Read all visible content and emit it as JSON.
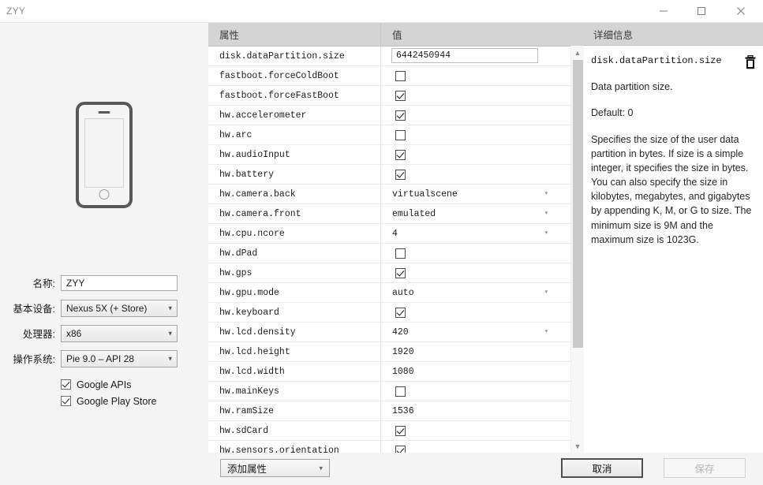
{
  "window": {
    "title": "ZYY",
    "controls": {
      "minimize": "minimize-icon",
      "maximize": "maximize-icon",
      "close": "close-icon"
    }
  },
  "sidebar": {
    "device_preview_icon": "phone-illustration",
    "fields": [
      {
        "label": "名称:",
        "type": "text",
        "value": "ZYY"
      },
      {
        "label": "基本设备:",
        "type": "combo",
        "value": "Nexus 5X (+ Store)"
      },
      {
        "label": "处理器:",
        "type": "combo",
        "value": "x86"
      },
      {
        "label": "操作系统:",
        "type": "combo",
        "value": "Pie 9.0 – API 28"
      }
    ],
    "checkboxes": [
      {
        "label": "Google APIs",
        "checked": true
      },
      {
        "label": "Google Play Store",
        "checked": true
      }
    ]
  },
  "table": {
    "headers": {
      "property": "属性",
      "value": "值"
    },
    "rows": [
      {
        "property": "disk.dataPartition.size",
        "type": "edit",
        "value": "6442450944"
      },
      {
        "property": "fastboot.forceColdBoot",
        "type": "checkbox",
        "checked": false
      },
      {
        "property": "fastboot.forceFastBoot",
        "type": "checkbox",
        "checked": true
      },
      {
        "property": "hw.accelerometer",
        "type": "checkbox",
        "checked": true
      },
      {
        "property": "hw.arc",
        "type": "checkbox",
        "checked": false
      },
      {
        "property": "hw.audioInput",
        "type": "checkbox",
        "checked": true
      },
      {
        "property": "hw.battery",
        "type": "checkbox",
        "checked": true
      },
      {
        "property": "hw.camera.back",
        "type": "combo",
        "value": "virtualscene"
      },
      {
        "property": "hw.camera.front",
        "type": "combo",
        "value": "emulated"
      },
      {
        "property": "hw.cpu.ncore",
        "type": "combo",
        "value": "4"
      },
      {
        "property": "hw.dPad",
        "type": "checkbox",
        "checked": false
      },
      {
        "property": "hw.gps",
        "type": "checkbox",
        "checked": true
      },
      {
        "property": "hw.gpu.mode",
        "type": "combo",
        "value": "auto"
      },
      {
        "property": "hw.keyboard",
        "type": "checkbox",
        "checked": true
      },
      {
        "property": "hw.lcd.density",
        "type": "combo",
        "value": "420"
      },
      {
        "property": "hw.lcd.height",
        "type": "text",
        "value": "1920"
      },
      {
        "property": "hw.lcd.width",
        "type": "text",
        "value": "1080"
      },
      {
        "property": "hw.mainKeys",
        "type": "checkbox",
        "checked": false
      },
      {
        "property": "hw.ramSize",
        "type": "text",
        "value": "1536"
      },
      {
        "property": "hw.sdCard",
        "type": "checkbox",
        "checked": true
      },
      {
        "property": "hw.sensors.orientation",
        "type": "checkbox",
        "checked": true
      }
    ],
    "scrollbar": {
      "up_icon": "chevron-up-icon",
      "down_icon": "chevron-down-icon"
    }
  },
  "detail": {
    "header": "详细信息",
    "property_name": "disk.dataPartition.size",
    "delete_icon": "trash-icon",
    "summary": "Data partition size.",
    "default": "Default: 0",
    "description": "Specifies the size of the user data partition in bytes. If size is a simple integer, it specifies the size in bytes. You can also specify the size in kilobytes, megabytes, and gigabytes by appending K, M, or G to size. The minimum size is 9M and the maximum size is 1023G."
  },
  "bottombar": {
    "add_property": "添加属性",
    "cancel": "取消",
    "save": "保存"
  }
}
